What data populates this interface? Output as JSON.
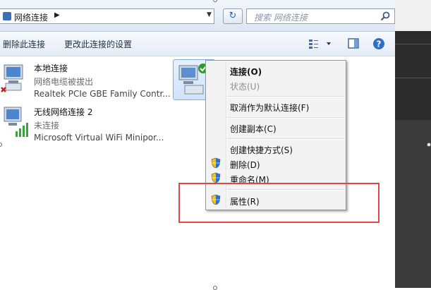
{
  "address": {
    "location": "网络连接"
  },
  "search": {
    "placeholder": "搜索 网络连接"
  },
  "commands": {
    "delete": "删除此连接",
    "change_settings": "更改此连接的设置"
  },
  "connections": [
    {
      "name": "本地连接",
      "status": "网络电缆被拔出",
      "device": "Realtek PCIe GBE Family Contr..."
    },
    {
      "name": "无线网络连接 2",
      "status": "未连接",
      "device": "Microsoft Virtual WiFi Minipor..."
    }
  ],
  "context_menu": {
    "connect": "连接(O)",
    "status": "状态(U)",
    "cancel_default": "取消作为默认连接(F)",
    "create_copy": "创建副本(C)",
    "create_shortcut": "创建快捷方式(S)",
    "delete": "删除(D)",
    "rename": "重命名(M)",
    "properties": "属性(R)"
  },
  "colors": {
    "highlight_box": "#e04646",
    "accent": "#3b6fb6"
  }
}
